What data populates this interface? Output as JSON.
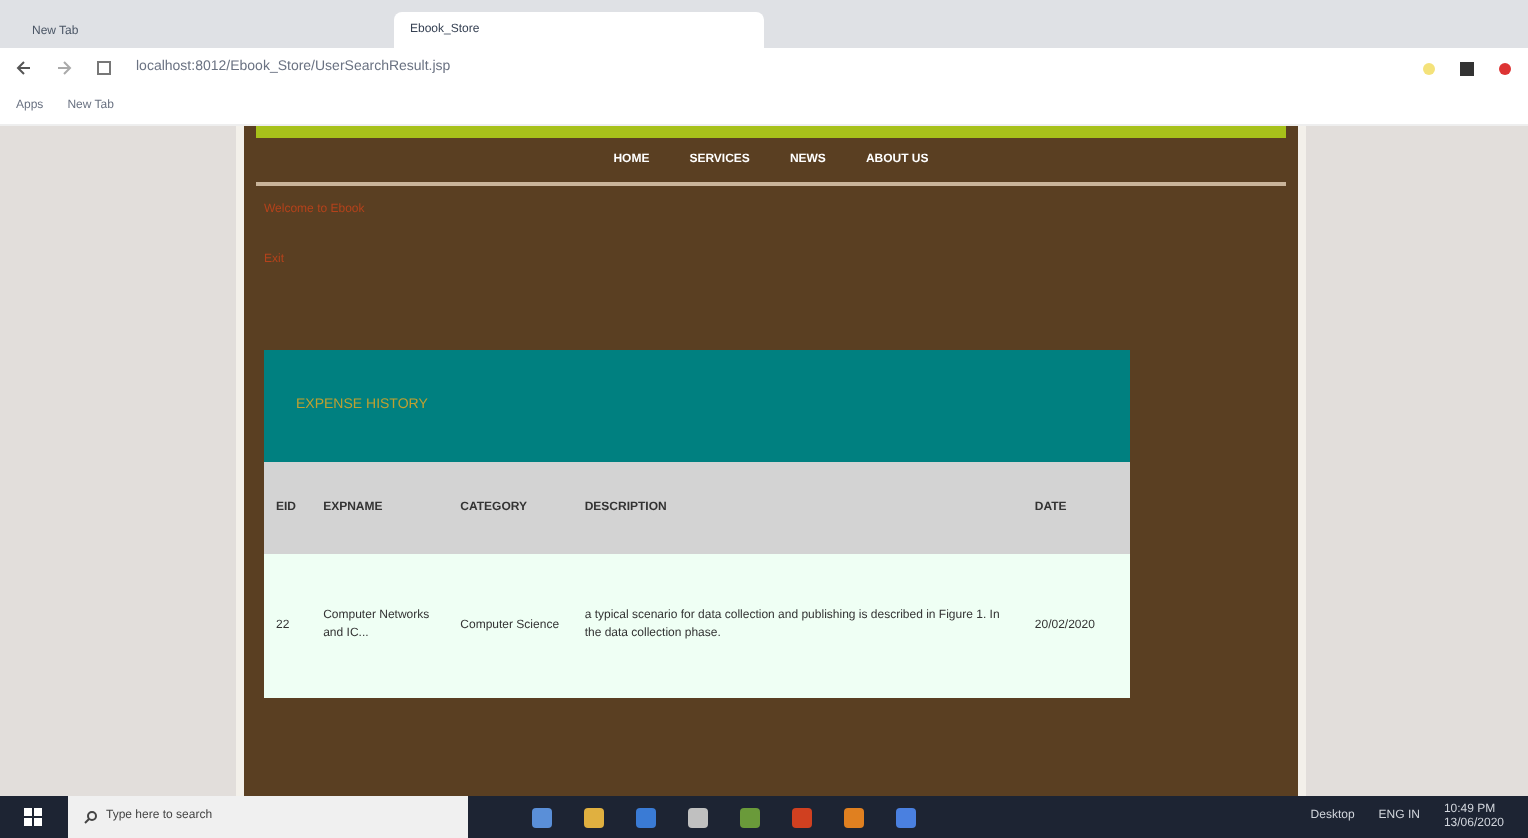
{
  "browser": {
    "tabs": [
      {
        "label": "New Tab",
        "selected": false
      },
      {
        "label": "Ebook_Store",
        "selected": true
      }
    ],
    "url": "localhost:8012/Ebook_Store/UserSearchResult.jsp",
    "bookmarks": [
      "Apps",
      "New Tab"
    ]
  },
  "nav": [
    "HOME",
    "SERVICES",
    "NEWS",
    "ABOUT US"
  ],
  "greeting": "Welcome to Ebook",
  "logout": "Exit",
  "panel_title": "EXPENSE HISTORY",
  "table": {
    "columns": [
      "EID",
      "EXPNAME",
      "CATEGORY",
      "DESCRIPTION",
      "DATE"
    ],
    "rows": [
      [
        "22",
        "Computer Networks and IC...",
        "Computer Science",
        "a typical scenario for data collection and publishing is described in Figure 1. In the data collection phase.",
        "20/02/2020"
      ]
    ]
  },
  "taskbar": {
    "search_placeholder": "Type here to search",
    "weather": "Desktop",
    "lang": "ENG IN",
    "time": "10:49 PM",
    "date": "13/06/2020"
  }
}
